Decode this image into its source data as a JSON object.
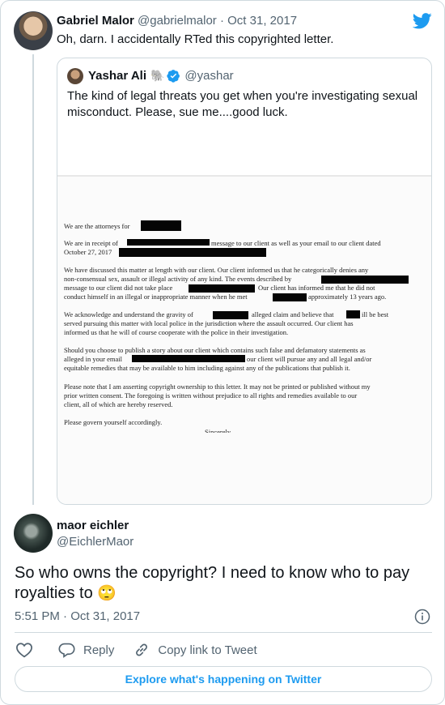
{
  "tweet": {
    "author_name": "Gabriel Malor",
    "handle": "@gabrielmalor",
    "separator": "·",
    "date": "Oct 31, 2017",
    "text": "Oh, darn. I accidentally RTed this copyrighted letter."
  },
  "quoted": {
    "author_name": "Yashar Ali",
    "emoji": "🐘",
    "handle": "@yashar",
    "text": "The kind of legal threats you get when you're investigating sexual misconduct. Please, sue me....good luck.",
    "letter": {
      "p1": "We are the attorneys for",
      "p2a": "We are in receipt of",
      "p2b": "message to our client as well as your email to our client dated",
      "p2c": "October 27, 2017",
      "p3a": "We have discussed this matter at length with our client. Our client informed us that he categorically denies any",
      "p3b": "non-consensual sex, assault or illegal activity of any kind. The events described by",
      "p3c": "message to our client did not take place",
      "p3d": "Our client has informed me that he did not",
      "p3e": "conduct himself in an illegal or inappropriate manner when he met",
      "p3f": "approximately 13 years ago.",
      "p4a": "We acknowledge and understand the gravity of",
      "p4b": "alleged claim and believe that",
      "p4c": "ill be best",
      "p4d": "served pursuing this matter with local police in the jurisdiction where the assault occurred.  Our client has",
      "p4e": "informed us that he will of course cooperate with the police in their investigation.",
      "p5a": "Should you choose to publish a story about our client which contains such false and defamatory statements as",
      "p5b": "alleged in your email",
      "p5c": "our client will pursue any and all legal and/or",
      "p5d": "equitable remedies that may be available to him including against any of the publications that publish it.",
      "p6a": "Please note that I am asserting copyright ownership to this letter.  It may not be printed or published without my",
      "p6b": "prior written consent.  The foregoing is written without prejudice to all rights and remedies available to our",
      "p6c": "client, all of which are hereby reserved.",
      "p7": "Please govern yourself accordingly.",
      "p8": "Sincerely,"
    }
  },
  "reply": {
    "author_name": "maor eichler",
    "handle": "@EichlerMaor",
    "text": "So who owns the copyright? I need to know who to pay royalties to",
    "emoji": "🙄",
    "time": "5:51 PM",
    "separator": "·",
    "date": "Oct 31, 2017"
  },
  "actions": {
    "reply_label": "Reply",
    "copy_link_label": "Copy link to Tweet"
  },
  "footer": {
    "explore_label": "Explore what's happening on Twitter"
  },
  "icons": {
    "brand": "twitter-bird-icon",
    "verified": "verified-badge-icon",
    "info": "info-icon",
    "like": "heart-icon",
    "reply": "reply-icon",
    "copy_link": "link-icon"
  },
  "colors": {
    "accent": "#1d9bf0",
    "text": "#0f1419",
    "muted": "#536471",
    "border": "#cfd9de",
    "like_hover": "#f91880"
  }
}
